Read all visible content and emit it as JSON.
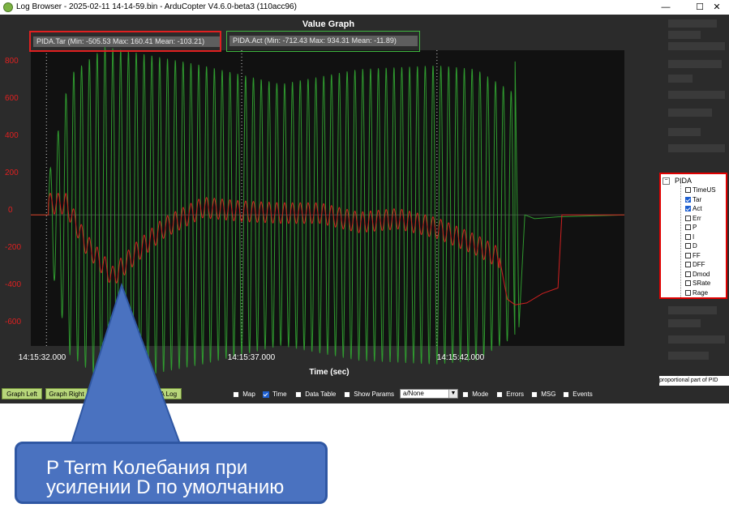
{
  "window": {
    "title": "Log Browser - 2025-02-11 14-14-59.bin - ArduCopter V4.6.0-beta3 (110acc96)",
    "minimize": "—",
    "maximize": "☐",
    "close": "✕"
  },
  "graph": {
    "title": "Value Graph",
    "legend": [
      {
        "label": "PIDA.Tar (Min: -505.53 Max: 160.41 Mean: -103.21)",
        "color": "#d02020"
      },
      {
        "label": "PIDA.Act (Min: -712.43 Max: 934.31 Mean: -11.89)",
        "color": "#2f9a2f"
      }
    ],
    "yticks": [
      "800",
      "600",
      "400",
      "200",
      "0",
      "-200",
      "-400",
      "-600"
    ],
    "xticks": [
      "14:15:32.000",
      "14:15:37.000",
      "14:15:42.000"
    ],
    "xlabel": "Time (sec)"
  },
  "chart_data": {
    "type": "line",
    "title": "Value Graph",
    "xlabel": "Time (sec)",
    "ylabel": "",
    "xlim": [
      "14:15:31.600",
      "14:15:46.800"
    ],
    "ylim": [
      -700,
      880
    ],
    "grid": false,
    "legend_position": "top-left",
    "series": [
      {
        "name": "PIDA.Tar",
        "color": "#d02020",
        "model": "oscillation",
        "segments": [
          {
            "t": [
              31.6,
              32.05
            ],
            "mean": 0,
            "amp": 0
          },
          {
            "t": [
              32.05,
              43.6
            ],
            "trend": [
              [
                32.05,
                60
              ],
              [
                32.5,
                60
              ],
              [
                33.0,
                -150
              ],
              [
                33.7,
                -330
              ],
              [
                34.3,
                -200
              ],
              [
                35.0,
                -70
              ],
              [
                36.0,
                40
              ],
              [
                37.0,
                20
              ],
              [
                38.0,
                10
              ],
              [
                39.0,
                10
              ],
              [
                40.0,
                -40
              ],
              [
                41.0,
                -20
              ],
              [
                42.0,
                -70
              ],
              [
                43.0,
                -160
              ],
              [
                43.6,
                -230
              ]
            ],
            "amp": 55,
            "freq_hz": 5.0
          },
          {
            "t": [
              43.6,
              46.8
            ],
            "points": [
              [
                43.6,
                -230
              ],
              [
                43.8,
                -450
              ],
              [
                44.0,
                -480
              ],
              [
                44.3,
                -470
              ],
              [
                44.7,
                -420
              ],
              [
                45.1,
                -390
              ],
              [
                45.2,
                0
              ],
              [
                46.8,
                0
              ]
            ]
          }
        ]
      },
      {
        "name": "PIDA.Act",
        "color": "#2f9a2f",
        "model": "oscillation",
        "segments": [
          {
            "t": [
              31.6,
              32.05
            ],
            "mean": 0,
            "amp": 0
          },
          {
            "t": [
              32.05,
              44.0
            ],
            "trend": [
              [
                32.05,
                0
              ],
              [
                33.0,
                0
              ],
              [
                44.0,
                0
              ]
            ],
            "amp_profile": [
              [
                32.05,
                200
              ],
              [
                32.6,
                750
              ],
              [
                33.5,
                900
              ],
              [
                36.0,
                800
              ],
              [
                38.0,
                700
              ],
              [
                40.0,
                780
              ],
              [
                42.0,
                800
              ],
              [
                43.0,
                780
              ],
              [
                44.0,
                650
              ]
            ],
            "freq_hz": 5.0
          },
          {
            "t": [
              44.0,
              46.8
            ],
            "points": [
              [
                44.0,
                820
              ],
              [
                44.1,
                -600
              ],
              [
                44.25,
                0
              ],
              [
                44.5,
                -20
              ],
              [
                45.1,
                -10
              ],
              [
                46.8,
                0
              ]
            ]
          }
        ]
      }
    ]
  },
  "tree": {
    "root": "PIDA",
    "items": [
      {
        "label": "TimeUS",
        "checked": false
      },
      {
        "label": "Tar",
        "checked": true
      },
      {
        "label": "Act",
        "checked": true
      },
      {
        "label": "Err",
        "checked": false
      },
      {
        "label": "P",
        "checked": false
      },
      {
        "label": "I",
        "checked": false
      },
      {
        "label": "D",
        "checked": false
      },
      {
        "label": "FF",
        "checked": false
      },
      {
        "label": "DFF",
        "checked": false
      },
      {
        "label": "Dmod",
        "checked": false
      },
      {
        "label": "SRate",
        "checked": false
      },
      {
        "label": "Rage",
        "checked": false
      }
    ]
  },
  "status": "proportional part of PID",
  "bottom": {
    "graph_left": "Graph Left",
    "graph_right": "Graph Right",
    "load_log": "Load A Log",
    "options": [
      {
        "label": "Map",
        "checked": false
      },
      {
        "label": "Time",
        "checked": true
      },
      {
        "label": "Data Table",
        "checked": false
      },
      {
        "label": "Show Params",
        "checked": false
      }
    ],
    "dropdown_value": "a/None",
    "options2": [
      {
        "label": "Mode",
        "checked": false
      },
      {
        "label": "Errors",
        "checked": false
      },
      {
        "label": "MSG",
        "checked": false
      },
      {
        "label": "Events",
        "checked": false
      }
    ]
  },
  "annotation": {
    "line1": "P Term Колебания при",
    "line2": "усилении D по умолчанию"
  }
}
